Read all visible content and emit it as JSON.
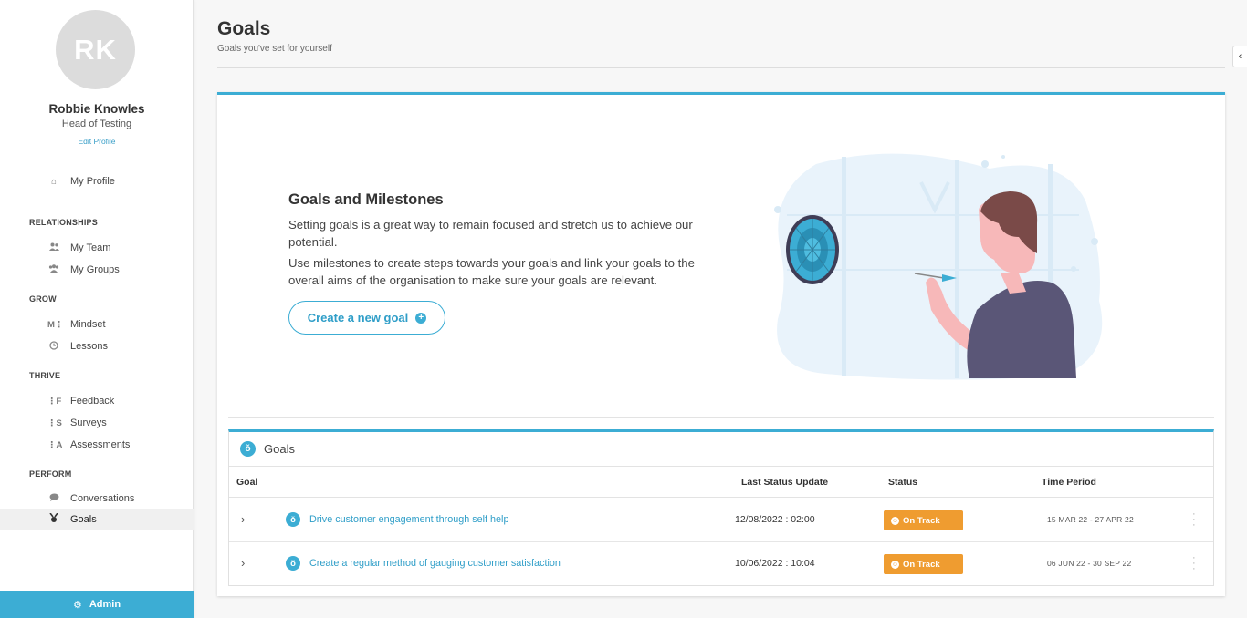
{
  "profile": {
    "initials": "RK",
    "name": "Robbie Knowles",
    "title": "Head of Testing",
    "edit_label": "Edit Profile"
  },
  "nav": {
    "my_profile": {
      "label": "My Profile",
      "icon": "home-icon"
    },
    "sections": {
      "relationships": "RELATIONSHIPS",
      "grow": "GROW",
      "thrive": "THRIVE",
      "perform": "PERFORM"
    },
    "my_team": {
      "label": "My Team",
      "icon": "people-icon"
    },
    "my_groups": {
      "label": "My Groups",
      "icon": "group-icon"
    },
    "mindset": {
      "label": "Mindset",
      "icon_text": "M⋮"
    },
    "lessons": {
      "label": "Lessons",
      "icon": "clock-icon"
    },
    "feedback": {
      "label": "Feedback",
      "icon_text": "⋮F"
    },
    "surveys": {
      "label": "Surveys",
      "icon_text": "⋮S"
    },
    "assessments": {
      "label": "Assessments",
      "icon_text": "⋮A"
    },
    "conversations": {
      "label": "Conversations",
      "icon": "chat-icon"
    },
    "goals": {
      "label": "Goals",
      "icon": "medal-icon",
      "active": true
    },
    "admin": {
      "label": "Admin",
      "icon": "gear-icon"
    }
  },
  "header": {
    "title": "Goals",
    "subtitle": "Goals you've set for yourself"
  },
  "hero": {
    "title": "Goals and Milestones",
    "paragraph1": "Setting goals is a great way to remain focused and stretch us to achieve our potential.",
    "paragraph2": "Use milestones to create steps towards your goals and link your goals to the overall aims of the organisation to make sure your goals are relevant.",
    "create_button": "Create a new goal"
  },
  "goals_table": {
    "heading": "Goals",
    "columns": {
      "goal": "Goal",
      "last_update": "Last Status Update",
      "status": "Status",
      "period": "Time Period"
    },
    "rows": [
      {
        "goal": "Drive customer engagement through self help",
        "last_update": "12/08/2022 : 02:00",
        "status": "On Track",
        "period": "15 MAR 22 - 27 APR 22"
      },
      {
        "goal": "Create a regular method of gauging customer satisfaction",
        "last_update": "10/06/2022 : 10:04",
        "status": "On Track",
        "period": "06 JUN 22 - 30 SEP 22"
      }
    ]
  },
  "colors": {
    "accent": "#3cadd4",
    "status_on_track": "#ef9c30",
    "illustration_background": "#e9f3fb",
    "figure_shirt": "#5a5677",
    "figure_hair": "#7a4a48",
    "figure_skin": "#f7b8b9"
  }
}
